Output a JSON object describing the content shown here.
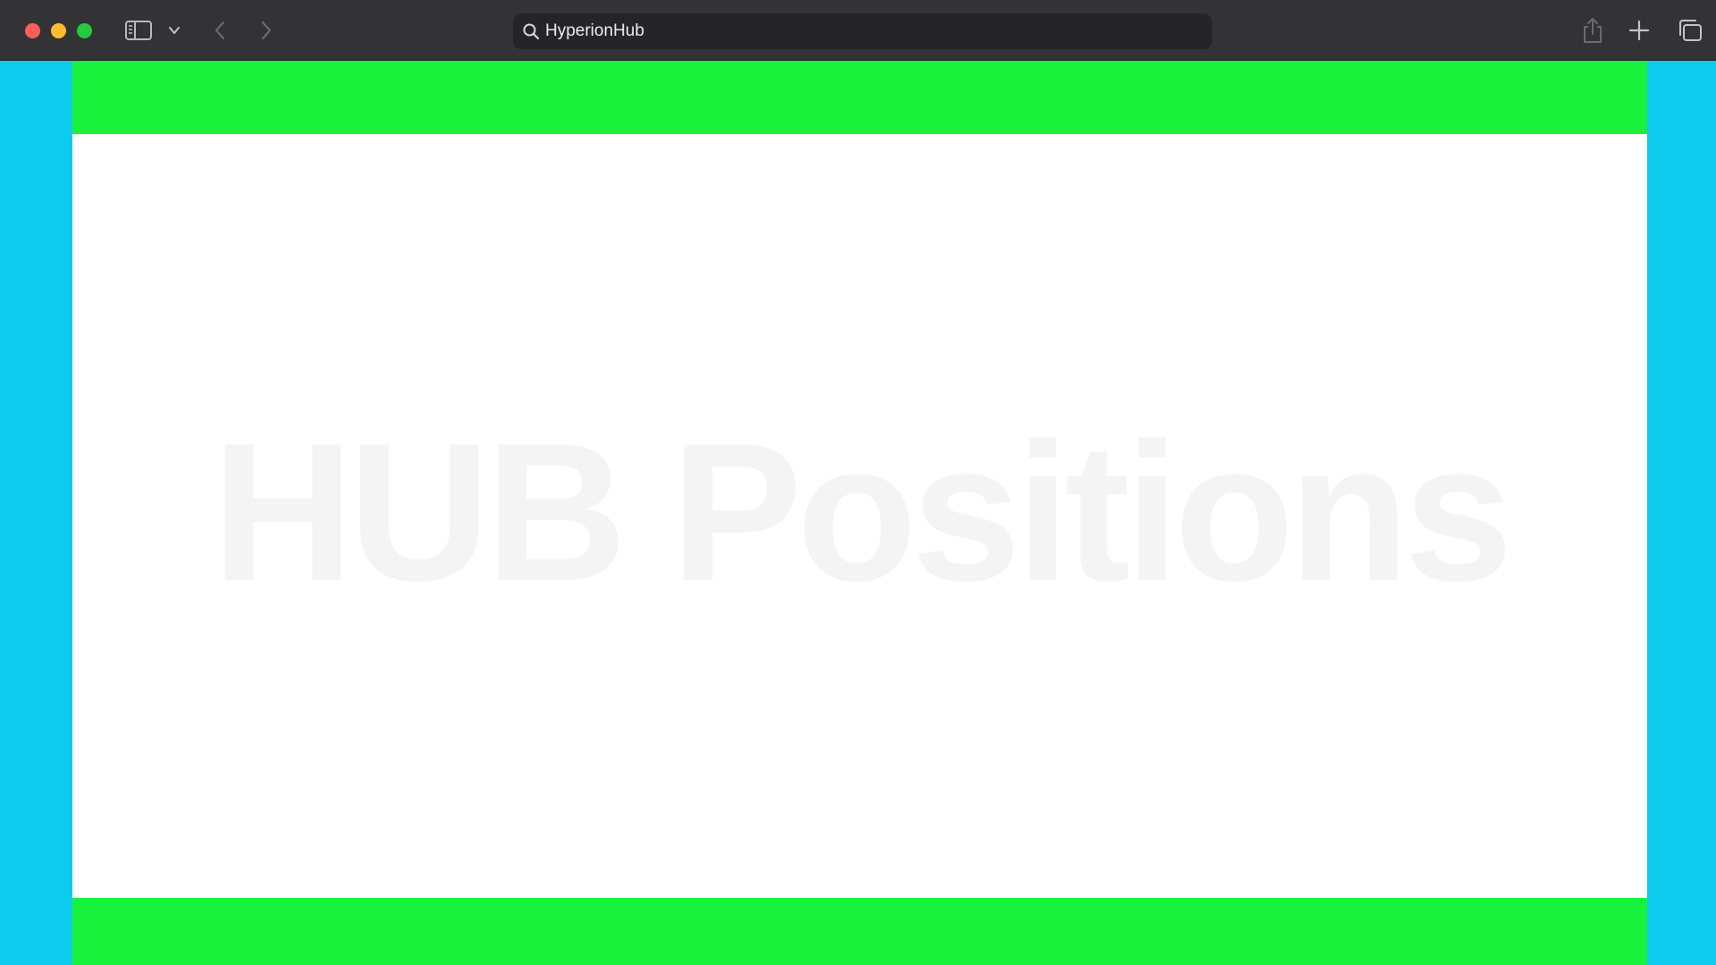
{
  "browser": {
    "address_bar": {
      "text": "HyperionHub"
    },
    "icons": {
      "sidebar_toggle": "sidebar-icon",
      "sidebar_menu": "chevron-down-icon",
      "back": "chevron-left-icon",
      "forward": "chevron-right-icon",
      "search": "search-icon",
      "share": "share-icon",
      "new_tab": "plus-icon",
      "tab_overview": "tabs-icon"
    }
  },
  "page": {
    "hero_title": "HUB Positions"
  },
  "colors": {
    "toolbar_bg": "#333336",
    "address_bar_bg": "#252527",
    "close": "#ff5f57",
    "minimize": "#febc2e",
    "zoom": "#28c840",
    "page_frame": "#0ccbec",
    "band": "#19f23a",
    "page_bg": "#ffffff",
    "hero_text": "#f4f4f4"
  }
}
